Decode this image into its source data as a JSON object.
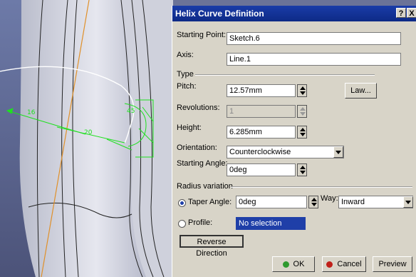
{
  "dialog": {
    "title": "Helix Curve Definition",
    "help_label": "?",
    "close_label": "X",
    "starting_point": {
      "label": "Starting Point:",
      "value": "Sketch.6"
    },
    "axis": {
      "label": "Axis:",
      "value": "Line.1"
    },
    "type_group": {
      "label": "Type",
      "pitch": {
        "label": "Pitch:",
        "value": "12.57mm"
      },
      "law_button": "Law...",
      "revolutions": {
        "label": "Revolutions:",
        "value": "1"
      },
      "height": {
        "label": "Height:",
        "value": "6.285mm"
      },
      "orientation": {
        "label": "Orientation:",
        "value": "Counterclockwise"
      },
      "starting_angle": {
        "label": "Starting Angle:",
        "value": "0deg"
      }
    },
    "radius_group": {
      "label": "Radius variation",
      "taper_angle": {
        "label": "Taper Angle:",
        "value": "0deg",
        "selected": true
      },
      "way": {
        "label": "Way:",
        "value": "Inward"
      },
      "profile": {
        "label": "Profile:",
        "value": "No selection",
        "selected": false
      }
    },
    "reverse_direction": "Reverse Direction",
    "ok": "OK",
    "cancel": "Cancel",
    "preview": "Preview"
  },
  "viewport": {
    "dimension_labels": [
      "16",
      "20",
      "45"
    ]
  },
  "colors": {
    "titlebar": "#0d2a86",
    "dialog_bg": "#d8d4c8",
    "selection_bg": "#1f3fa8",
    "ok_icon": "#2e9a2e",
    "cancel_icon": "#c0201a"
  }
}
